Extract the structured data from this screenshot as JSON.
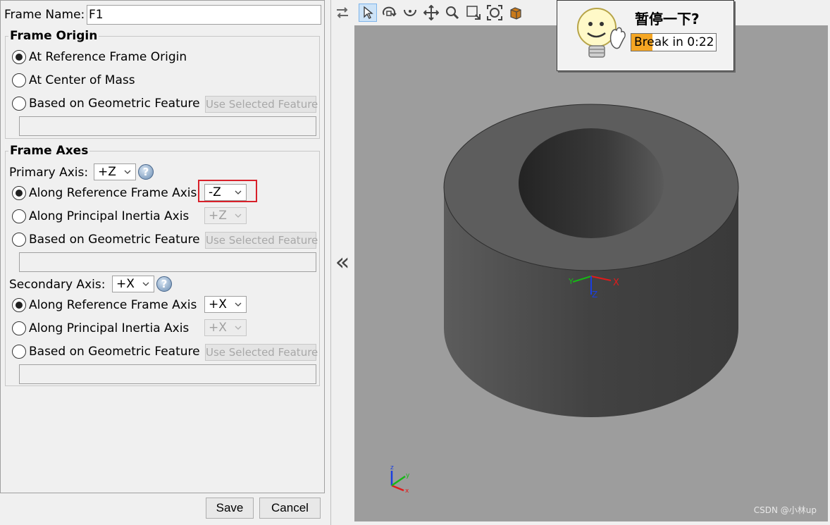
{
  "frame": {
    "name_label": "Frame Name:",
    "name_value": "F1"
  },
  "origin": {
    "title": "Frame Origin",
    "options": [
      "At Reference Frame Origin",
      "At Center of Mass",
      "Based on Geometric Feature"
    ],
    "selected_index": 0,
    "use_feature_label": "Use Selected Feature"
  },
  "axes": {
    "title": "Frame Axes",
    "primary": {
      "label": "Primary Axis:",
      "value": "+Z",
      "options": [
        "Along Reference Frame Axis",
        "Along Principal Inertia Axis",
        "Based on Geometric Feature"
      ],
      "selected_index": 0,
      "ref_axis_value": "-Z",
      "inertia_axis_value": "+Z",
      "use_feature_label": "Use Selected Feature"
    },
    "secondary": {
      "label": "Secondary Axis:",
      "value": "+X",
      "options": [
        "Along Reference Frame Axis",
        "Along Principal Inertia Axis",
        "Based on Geometric Feature"
      ],
      "selected_index": 0,
      "ref_axis_value": "+X",
      "inertia_axis_value": "+X",
      "use_feature_label": "Use Selected Feature"
    },
    "help_glyph": "?"
  },
  "buttons": {
    "save": "Save",
    "cancel": "Cancel"
  },
  "popup": {
    "title": "暂停一下?",
    "countdown": "Break in 0:22",
    "progress_fraction": 0.25
  },
  "viewer": {
    "collapse_glyph": "«",
    "watermark": "CSDN @小林up",
    "axis_labels": {
      "x": "X",
      "y": "Y",
      "z": "Z"
    },
    "small_axis_labels": {
      "x": "x",
      "y": "y",
      "z": "z"
    }
  },
  "icons": [
    "swap-icon",
    "select-arrow-icon",
    "rotate-icon",
    "rotate-about-icon",
    "pan-icon",
    "zoom-icon",
    "zoom-box-icon",
    "zoom-fit-icon",
    "view-cube-icon"
  ],
  "colors": {
    "highlight_box": "#d8202a",
    "axis_x": "#e11b1b",
    "axis_y": "#16b816",
    "axis_z": "#1a3fe0",
    "progress": "#f5a623"
  }
}
